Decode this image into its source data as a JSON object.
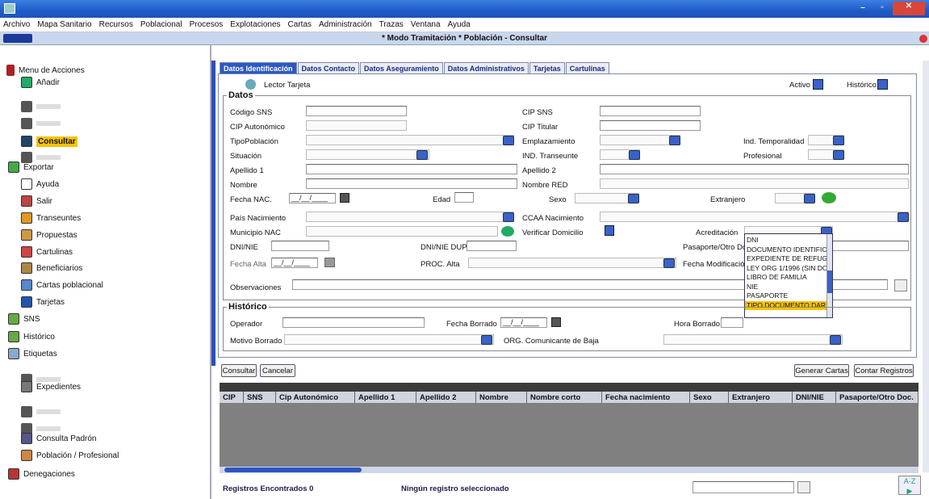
{
  "menu": [
    "Archivo",
    "Mapa Sanitario",
    "Recursos",
    "Poblacional",
    "Procesos",
    "Explotaciones",
    "Cartas",
    "Administración",
    "Trazas",
    "Ventana",
    "Ayuda"
  ],
  "window_title": "* Modo Tramitación *   Población - Consultar",
  "sidebar": {
    "header": "Menu de Acciones",
    "items": [
      "Añadir",
      "Consultar",
      "Exportar",
      "Ayuda",
      "Salir",
      "Transeuntes",
      "Propuestas",
      "Cartulinas",
      "Beneficiarios",
      "Cartas poblacional",
      "Tarjetas",
      "SNS",
      "Histórico",
      "Etiquetas",
      "Expedientes",
      "Consulta Padrón",
      "Población / Profesional",
      "Denegaciones"
    ]
  },
  "tabs": [
    "Datos Identificación",
    "Datos Contacto",
    "Datos Aseguramiento",
    "Datos Administrativos",
    "Tarjetas",
    "Cartulinas"
  ],
  "lector": "Lector Tarjeta",
  "activo": "Activo",
  "historico_chk": "Histórico",
  "datos": {
    "title": "Datos",
    "codigo_sns": "Código SNS",
    "cip_sns": "CIP SNS",
    "cip_auto": "CIP Autonómico",
    "cip_titular": "CIP Titular",
    "tipo_pob": "TipoPoblación",
    "emplazamiento": "Emplazamiento",
    "ind_temp": "Ind. Temporalidad",
    "situacion": "Situación",
    "ind_trans": "IND. Transeunte",
    "profesional": "Profesional",
    "apellido1": "Apellido 1",
    "apellido2": "Apellido 2",
    "nombre": "Nombre",
    "nombre_red": "Nombre RED",
    "fecha_nac": "Fecha NAC.",
    "fecha_nac_val": "__/__/____",
    "edad": "Edad",
    "sexo": "Sexo",
    "extranjero": "Extranjero",
    "pais_nac": "País Nacimiento",
    "ccaa_nac": "CCAA Nacimiento",
    "mun_nac": "Municipio NAC",
    "verificar": "Verificar Domicilio",
    "acreditacion": "Acreditación",
    "dni": "DNI/NIE",
    "dni_dup": "DNI/NIE DUP.",
    "pasaporte": "Pasaporte/Otro Do",
    "fecha_alta": "Fecha Alta",
    "fecha_alta_val": "__/__/____",
    "proc_alta": "PROC. Alta",
    "fecha_mod": "Fecha Modificació",
    "observaciones": "Observaciones"
  },
  "dropdown": [
    "DNI",
    "DOCUMENTO IDENTIFICA",
    "EXPEDIENTE DE REFUGI",
    "LEY ORG 1/1996 (SIN DO",
    "LIBRO DE FAMILIA",
    "NIE",
    "PASAPORTE",
    "TIPO DOCUMENTO DAR"
  ],
  "historico": {
    "title": "Histórico",
    "operador": "Operador",
    "fecha_borrado": "Fecha Borrado",
    "fecha_val": "__/__/____",
    "hora_borrado": "Hora Borrado",
    "motivo": "Motivo Borrado",
    "org": "ORG. Comunicante de Baja"
  },
  "buttons": {
    "consultar": "Consultar",
    "cancelar": "Cancelar",
    "generar": "Generar Cartas",
    "contar": "Contar Registros"
  },
  "columns": [
    "CIP",
    "SNS",
    "Cip Autonómico",
    "Apellido 1",
    "Apellido 2",
    "Nombre",
    "Nombre corto",
    "Fecha nacimiento",
    "Sexo",
    "Extranjero",
    "DNI/NIE",
    "Pasaporte/Otro Doc."
  ],
  "status": {
    "found": "Registros Encontrados 0",
    "none": "Ningún registro seleccionado",
    "az": "A-Z"
  }
}
